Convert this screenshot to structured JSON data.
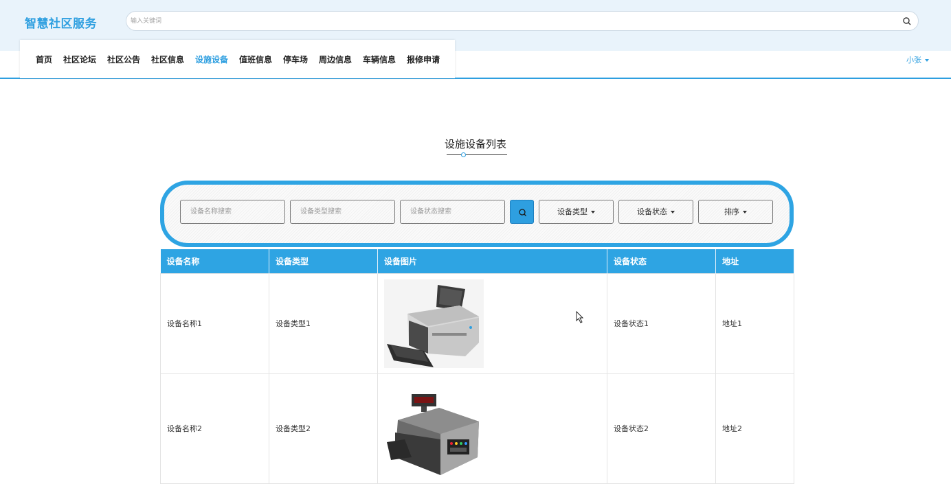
{
  "header": {
    "brand": "智慧社区服务",
    "search_placeholder": "输入关键词"
  },
  "nav": {
    "items": [
      {
        "label": "首页"
      },
      {
        "label": "社区论坛"
      },
      {
        "label": "社区公告"
      },
      {
        "label": "社区信息"
      },
      {
        "label": "设施设备",
        "active": true
      },
      {
        "label": "值班信息"
      },
      {
        "label": "停车场"
      },
      {
        "label": "周边信息"
      },
      {
        "label": "车辆信息"
      },
      {
        "label": "报修申请"
      }
    ],
    "user": "小张"
  },
  "page": {
    "title": "设施设备列表"
  },
  "filters": {
    "name_placeholder": "设备名称搜索",
    "type_placeholder": "设备类型搜索",
    "status_placeholder": "设备状态搜索",
    "dropdown_type": "设备类型",
    "dropdown_status": "设备状态",
    "dropdown_sort": "排序"
  },
  "table": {
    "headers": [
      "设备名称",
      "设备类型",
      "设备图片",
      "设备状态",
      "地址"
    ],
    "rows": [
      {
        "name": "设备名称1",
        "type": "设备类型1",
        "image": "printer-image",
        "status": "设备状态1",
        "address": "地址1"
      },
      {
        "name": "设备名称2",
        "type": "设备类型2",
        "image": "cash-counter-image",
        "status": "设备状态2",
        "address": "地址2"
      }
    ]
  },
  "colors": {
    "accent": "#2e9fe0",
    "header_bg": "#e9f3fb"
  }
}
